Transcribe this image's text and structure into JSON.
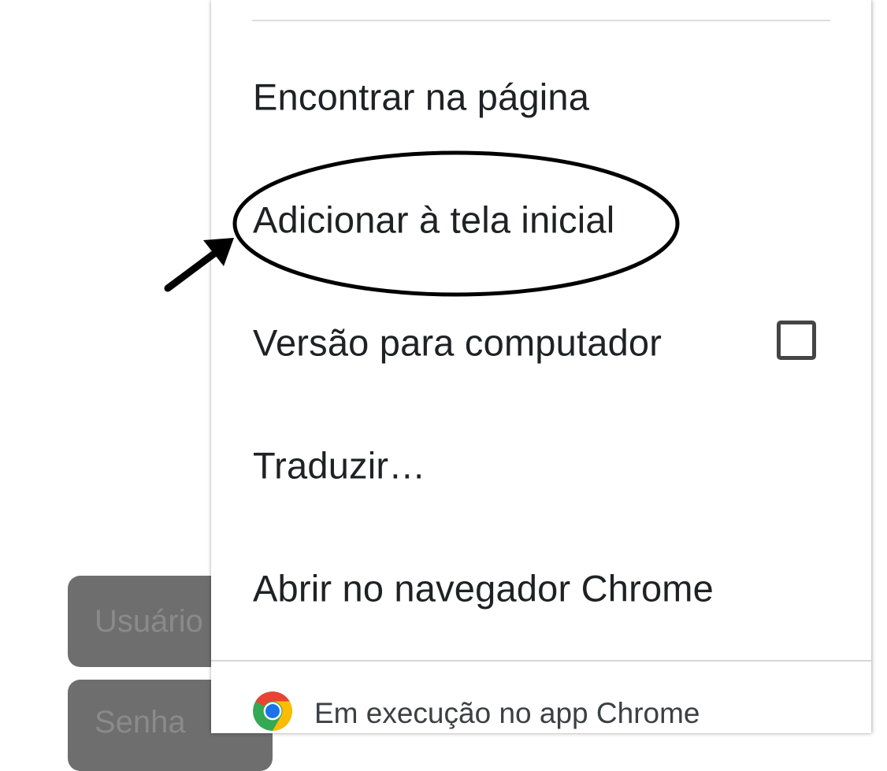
{
  "background": {
    "username_placeholder": "Usuário",
    "password_placeholder": "Senha"
  },
  "menu": {
    "items": [
      {
        "label": "Encontrar na página"
      },
      {
        "label": "Adicionar à tela inicial"
      },
      {
        "label": "Versão para computador",
        "checkbox_checked": false
      },
      {
        "label": "Traduzir…"
      },
      {
        "label": "Abrir no navegador Chrome"
      }
    ],
    "footer_text": "Em execução no app Chrome"
  },
  "annotation": {
    "highlighted_item": "Adicionar à tela inicial",
    "stroke_color": "#000000"
  },
  "colors": {
    "menu_text": "#202124",
    "footer_text": "#3c4043",
    "background_field": "#6e6e6e",
    "chrome_red": "#ea4335",
    "chrome_yellow": "#fbbc04",
    "chrome_green": "#34a853",
    "chrome_blue": "#1a73e8"
  }
}
